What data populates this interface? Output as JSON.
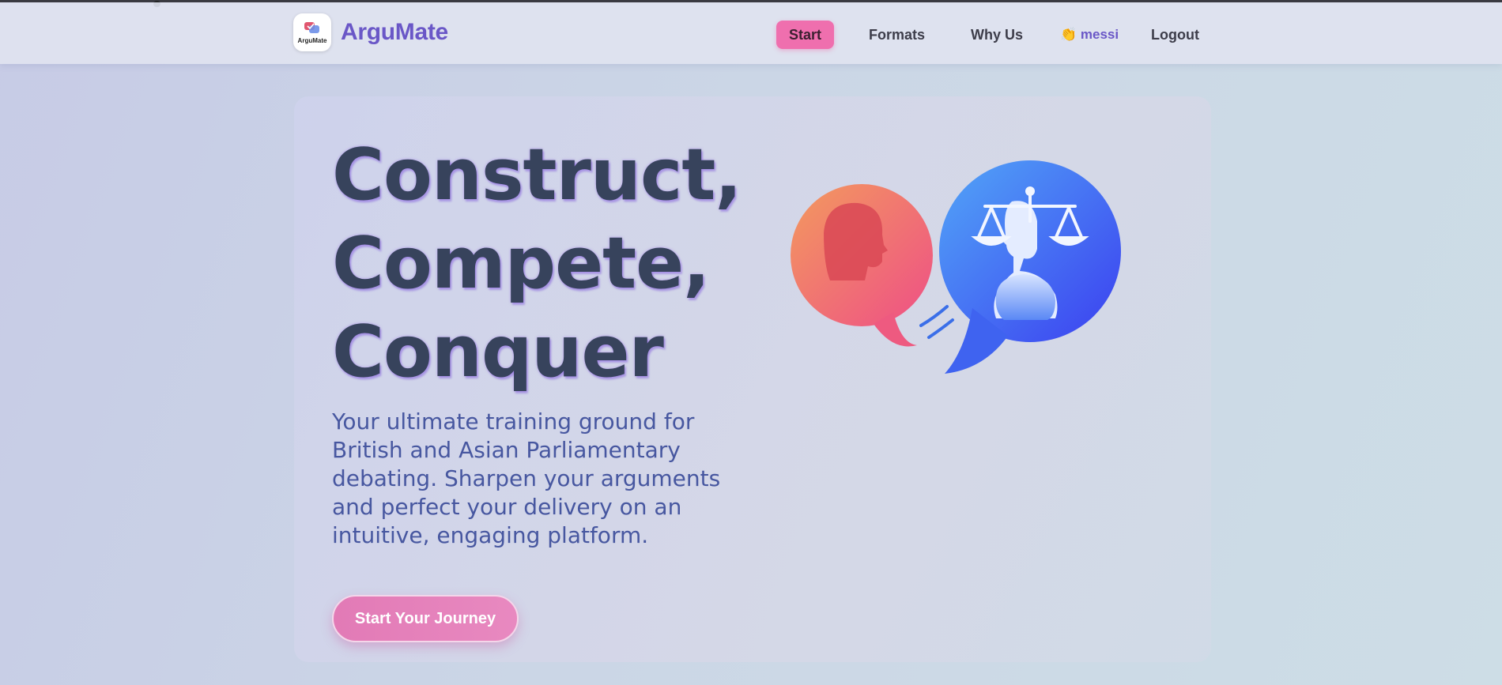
{
  "brand": {
    "logo_text": "ArguMate",
    "name": "ArguMate"
  },
  "nav": {
    "start": "Start",
    "formats": "Formats",
    "why_us": "Why Us",
    "user": "👏 messi",
    "logout": "Logout"
  },
  "hero": {
    "headline": [
      "Construct,",
      "Compete,",
      "Conquer"
    ],
    "subtitle": "Your ultimate training ground for British and Asian Parliamentary debating. Sharpen your arguments and perfect your delivery on an intuitive, engaging platform.",
    "cta": "Start Your Journey"
  },
  "colors": {
    "brand": "#6a57c7",
    "accent_pink": "#ef6fae",
    "headline": "#37435c",
    "subtitle": "#4757a0"
  },
  "icons": {
    "logo": "chat-bubbles-check-icon",
    "illustration": "debate-speech-bubbles-scales-icon"
  }
}
